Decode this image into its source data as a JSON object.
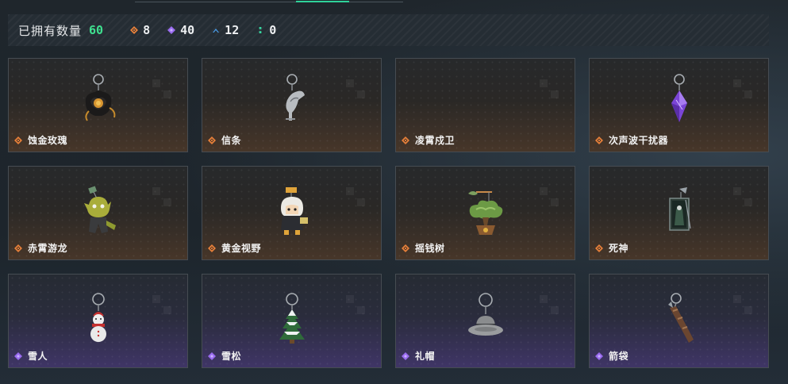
{
  "summary": {
    "owned_label": "已拥有数量",
    "owned_total": "60",
    "counts": [
      {
        "rarity": "orange",
        "icon": "orange-diamond-icon",
        "color": "#e8803a",
        "value": "8"
      },
      {
        "rarity": "purple",
        "icon": "purple-diamond-icon",
        "color": "#9a6cf0",
        "value": "40"
      },
      {
        "rarity": "blue",
        "icon": "blue-chevron-icon",
        "color": "#4a9ce8",
        "value": "12"
      },
      {
        "rarity": "green",
        "icon": "green-dots-icon",
        "color": "#37d6a0",
        "value": "0"
      }
    ]
  },
  "items": [
    {
      "name": "蚀金玫瑰",
      "rarity": "orange",
      "icon": "black-rose-charm-icon"
    },
    {
      "name": "信条",
      "rarity": "orange",
      "icon": "silver-bird-charm-icon"
    },
    {
      "name": "凌霄戍卫",
      "rarity": "orange",
      "icon": ""
    },
    {
      "name": "次声波干扰器",
      "rarity": "orange",
      "icon": "purple-crystal-charm-icon"
    },
    {
      "name": "赤霄游龙",
      "rarity": "orange",
      "icon": "yellow-dragon-figure-icon"
    },
    {
      "name": "黄金视野",
      "rarity": "orange",
      "icon": "white-hair-figure-icon"
    },
    {
      "name": "摇钱树",
      "rarity": "orange",
      "icon": "money-tree-bonsai-icon"
    },
    {
      "name": "死神",
      "rarity": "orange",
      "icon": "reaper-card-icon"
    },
    {
      "name": "雪人",
      "rarity": "purple",
      "icon": "snowman-charm-icon"
    },
    {
      "name": "雪松",
      "rarity": "purple",
      "icon": "snowy-pine-charm-icon"
    },
    {
      "name": "礼帽",
      "rarity": "purple",
      "icon": "grey-fedora-charm-icon"
    },
    {
      "name": "箭袋",
      "rarity": "purple",
      "icon": "arrow-quiver-charm-icon"
    }
  ]
}
